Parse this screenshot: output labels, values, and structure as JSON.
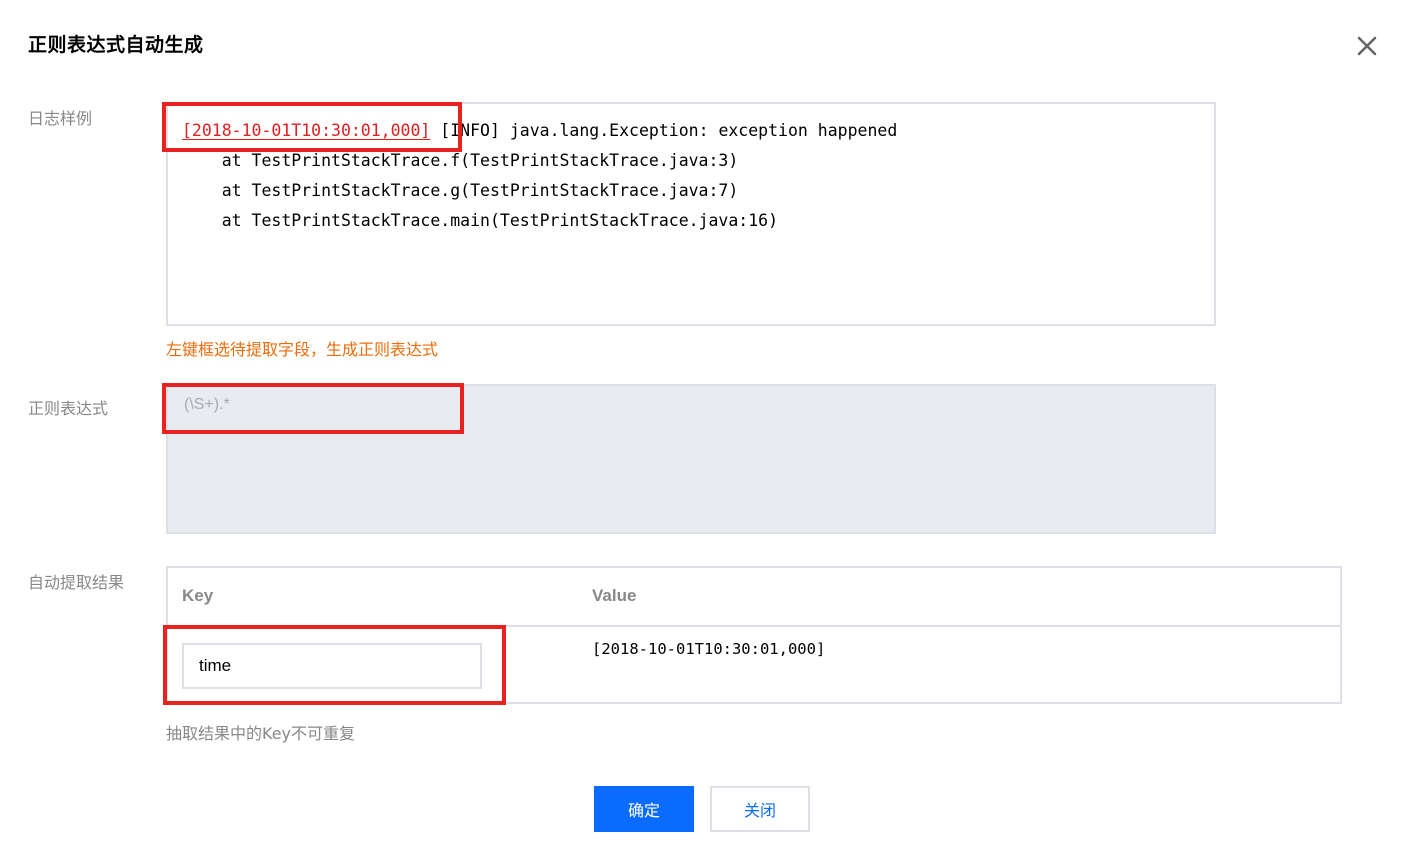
{
  "dialog": {
    "title": "正则表达式自动生成",
    "close_icon": "close-icon"
  },
  "sample": {
    "label": "日志样例",
    "selected": "[2018-10-01T10:30:01,000]",
    "line1_rest": " [INFO] java.lang.Exception: exception happened",
    "lines": [
      "    at TestPrintStackTrace.f(TestPrintStackTrace.java:3)",
      "    at TestPrintStackTrace.g(TestPrintStackTrace.java:7)",
      "    at TestPrintStackTrace.main(TestPrintStackTrace.java:16)"
    ],
    "hint": "左键框选待提取字段，生成正则表达式"
  },
  "regex": {
    "label": "正则表达式",
    "value": "(\\S+).*"
  },
  "result": {
    "label": "自动提取结果",
    "columns": [
      "Key",
      "Value"
    ],
    "rows": [
      {
        "key": "time",
        "value": "[2018-10-01T10:30:01,000]"
      }
    ],
    "hint": "抽取结果中的Key不可重复"
  },
  "buttons": {
    "confirm": "确定",
    "close": "关闭"
  },
  "colors": {
    "primary": "#0a6cff",
    "highlight": "#e8231f",
    "hint_orange": "#f06b0a"
  }
}
